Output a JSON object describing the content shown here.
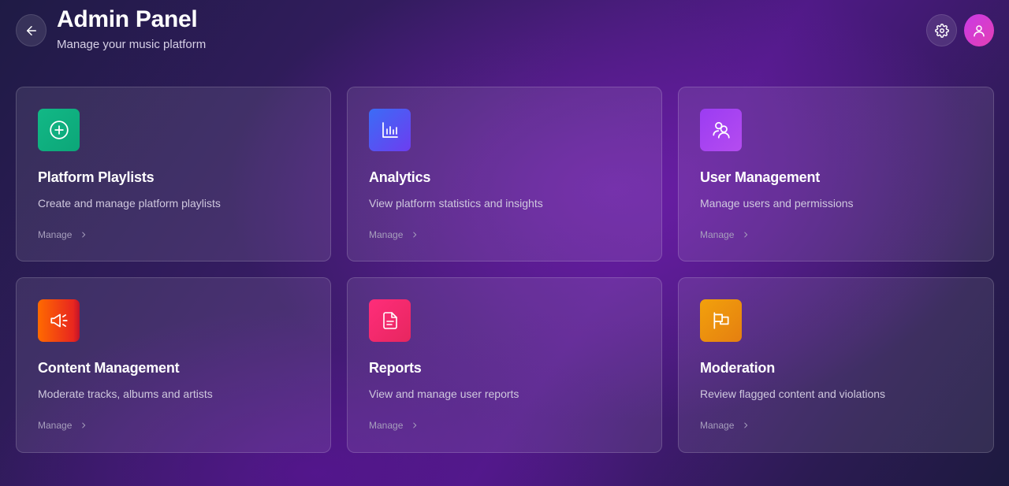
{
  "header": {
    "title": "Admin Panel",
    "subtitle": "Manage your music platform",
    "back_icon": "arrow-left-icon",
    "settings_icon": "gear-icon",
    "profile_icon": "user-icon"
  },
  "cards": [
    {
      "title": "Platform Playlists",
      "description": "Create and manage platform playlists",
      "link": "Manage",
      "icon": "plus-circle-icon",
      "color": "#12b886"
    },
    {
      "title": "Analytics",
      "description": "View platform statistics and insights",
      "link": "Manage",
      "icon": "bar-chart-icon",
      "color": "#3b6cf6"
    },
    {
      "title": "User Management",
      "description": "Manage users and permissions",
      "link": "Manage",
      "icon": "users-icon",
      "color": "#9b3cf2"
    },
    {
      "title": "Content Management",
      "description": "Moderate tracks, albums and artists",
      "link": "Manage",
      "icon": "megaphone-icon",
      "color": "#ff6a00"
    },
    {
      "title": "Reports",
      "description": "View and manage user reports",
      "link": "Manage",
      "icon": "document-icon",
      "color": "#ff2d7a"
    },
    {
      "title": "Moderation",
      "description": "Review flagged content and violations",
      "link": "Manage",
      "icon": "flag-icon",
      "color": "#f2a10c"
    }
  ]
}
